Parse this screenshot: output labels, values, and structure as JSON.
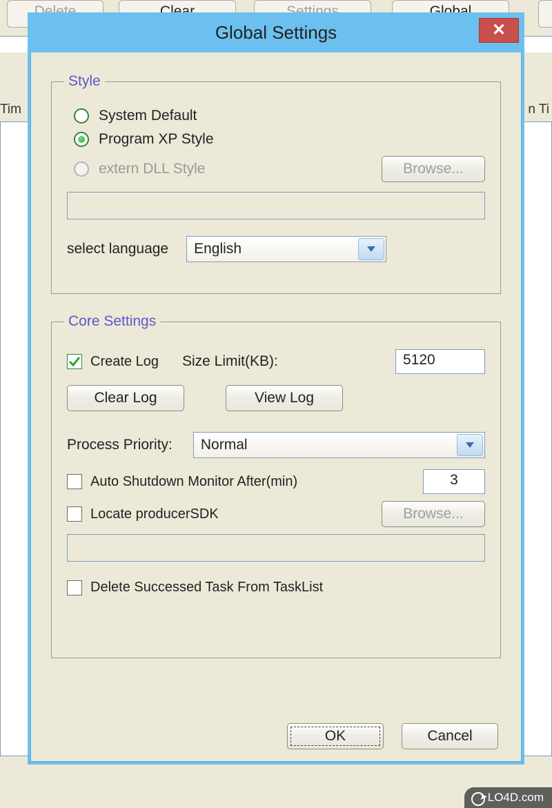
{
  "background": {
    "buttons": {
      "delete": "Delete",
      "clear": "Clear",
      "settings": "Settings",
      "global": "Global"
    },
    "label_left": "Tim",
    "label_right": "n Ti"
  },
  "dialog": {
    "title": "Global Settings",
    "close_glyph": "✕"
  },
  "style_group": {
    "legend": "Style",
    "radio_system": "System Default",
    "radio_xp": "Program XP Style",
    "radio_dll": "extern DLL Style",
    "browse": "Browse...",
    "lang_label": "select language",
    "lang_value": "English"
  },
  "core_group": {
    "legend": "Core Settings",
    "create_log": "Create Log",
    "size_limit_label": "Size Limit(KB):",
    "size_limit_value": "5120",
    "clear_log": "Clear Log",
    "view_log": "View Log",
    "priority_label": "Process Priority:",
    "priority_value": "Normal",
    "auto_shutdown": "Auto Shutdown Monitor After(min)",
    "auto_shutdown_value": "3",
    "locate_sdk": "Locate producerSDK",
    "browse2": "Browse...",
    "delete_successed": "Delete Successed Task From TaskList"
  },
  "buttons": {
    "ok": "OK",
    "cancel": "Cancel"
  },
  "watermark": "LO4D.com"
}
